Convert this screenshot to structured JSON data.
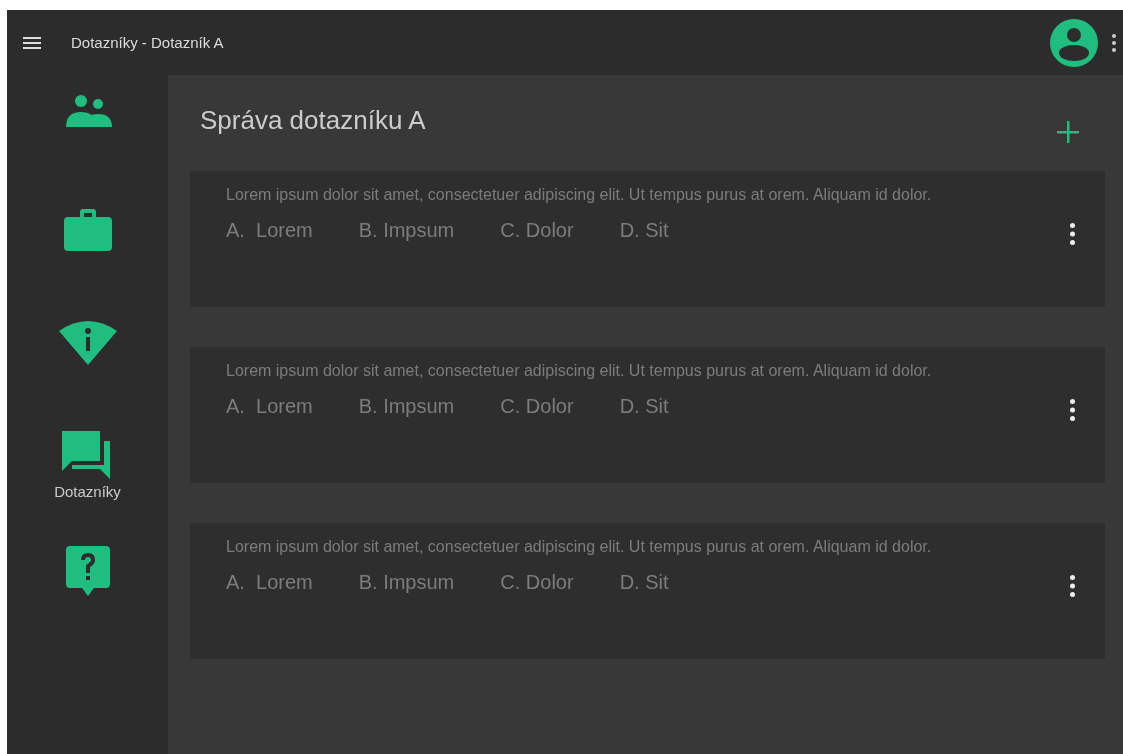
{
  "app_bar": {
    "title": "Dotazníky - Dotazník A"
  },
  "sidebar": {
    "items": [
      {
        "kind": "people",
        "selected": false
      },
      {
        "kind": "briefcase",
        "selected": false
      },
      {
        "kind": "info",
        "selected": false
      },
      {
        "kind": "chat",
        "label": "Dotazníky",
        "selected": true
      },
      {
        "kind": "help",
        "selected": false
      }
    ]
  },
  "main": {
    "heading": "Správa dotazníku A",
    "questions": [
      {
        "text": "Lorem ipsum dolor sit amet, consectetuer adipiscing elit. Ut tempus purus at orem. Aliquam id dolor.",
        "options": [
          "A.  Lorem",
          "B. Impsum",
          "C. Dolor",
          "D. Sit"
        ]
      },
      {
        "text": "Lorem ipsum dolor sit amet, consectetuer adipiscing elit. Ut tempus purus at orem. Aliquam id dolor.",
        "options": [
          "A.  Lorem",
          "B. Impsum",
          "C. Dolor",
          "D. Sit"
        ]
      },
      {
        "text": "Lorem ipsum dolor sit amet, consectetuer adipiscing elit. Ut tempus purus at orem. Aliquam id dolor.",
        "options": [
          "A.  Lorem",
          "B. Impsum",
          "C. Dolor",
          "D. Sit"
        ]
      }
    ]
  }
}
